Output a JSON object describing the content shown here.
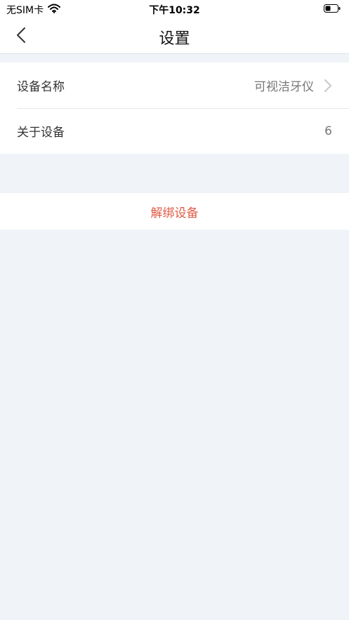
{
  "status_bar": {
    "carrier": "无SIM卡",
    "time": "下午10:32"
  },
  "nav": {
    "title": "设置",
    "back_icon": "chevron-left-icon"
  },
  "settings": {
    "device_name": {
      "label": "设备名称",
      "value": "可视洁牙仪",
      "icon": "chevron-right-icon"
    },
    "about_device": {
      "label": "关于设备",
      "value": "6"
    }
  },
  "unbind": {
    "label": "解绑设备",
    "color": "#e15a44"
  }
}
